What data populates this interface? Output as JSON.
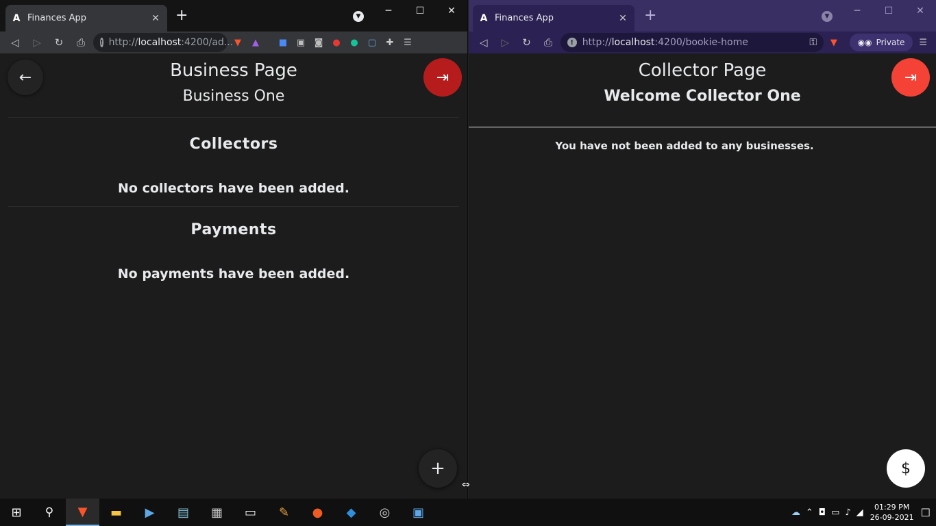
{
  "left_browser": {
    "tab_title": "Finances App",
    "tab_close": "✕",
    "new_tab": "+",
    "window_controls": [
      "─",
      "☐",
      "✕"
    ],
    "url_prefix": "http://",
    "url_host": "localhost",
    "url_rest": ":4200/ad...",
    "page": {
      "title": "Business Page",
      "subtitle": "Business One",
      "collectors_heading": "Collectors",
      "collectors_empty": "No collectors have been added.",
      "payments_heading": "Payments",
      "payments_empty": "No payments have been added.",
      "add_icon": "+",
      "back_icon": "←",
      "exit_icon": "⇥"
    }
  },
  "right_browser": {
    "tab_title": "Finances App",
    "tab_close": "✕",
    "new_tab": "+",
    "window_controls": [
      "─",
      "☐",
      "✕"
    ],
    "url_prefix": "http://",
    "url_host": "localhost",
    "url_rest": ":4200/bookie-home",
    "private_label": "Private",
    "page": {
      "title": "Collector Page",
      "subtitle": "Welcome Collector One",
      "empty": "You have not been added to any businesses.",
      "pay_icon": "$",
      "exit_icon": "⇥"
    }
  },
  "taskbar": {
    "time": "01:29 PM",
    "date": "26-09-2021",
    "apps": [
      "brave-icon",
      "file-explorer-icon",
      "media-player-icon",
      "notepad-icon",
      "control-panel-icon",
      "terminal-icon",
      "paint-icon",
      "postman-icon",
      "vscode-icon",
      "obs-icon",
      "screen-recorder-icon"
    ]
  },
  "colors": {
    "exit_red_left": "#b71c1c",
    "exit_red_right": "#f44336",
    "private_purple": "#3a2f63"
  }
}
